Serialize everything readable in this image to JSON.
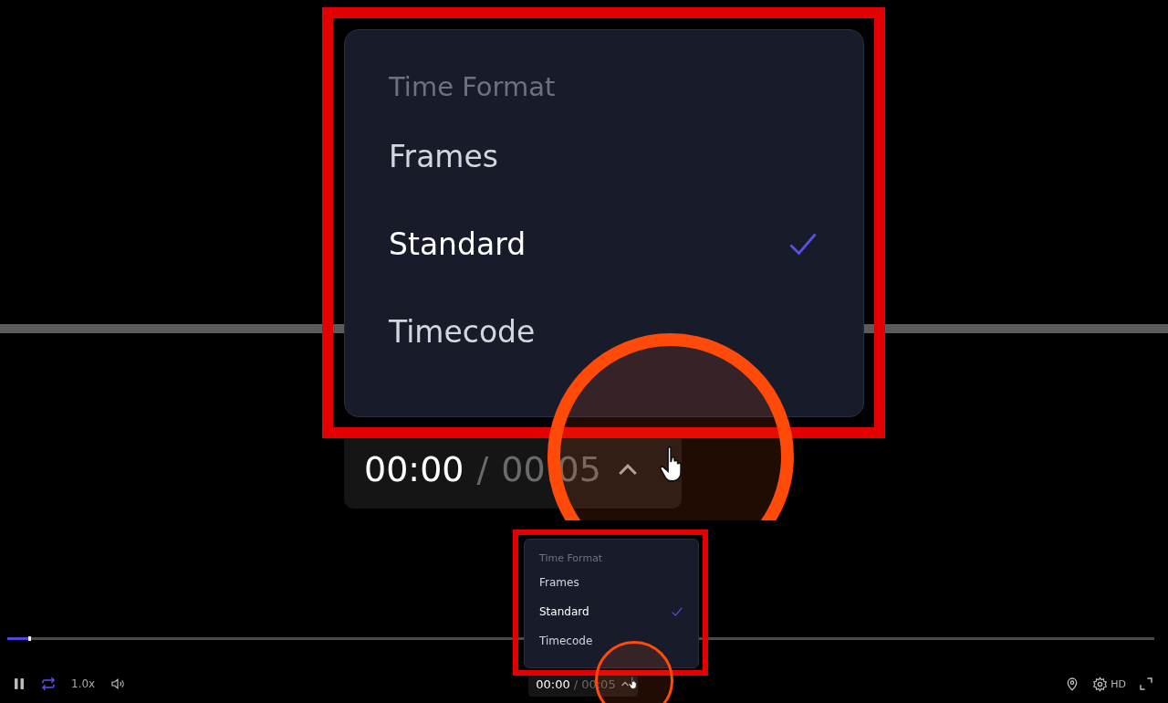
{
  "zoom_inset": {
    "menu": {
      "title": "Time Format",
      "items": [
        {
          "label": "Frames",
          "selected": false
        },
        {
          "label": "Standard",
          "selected": true
        },
        {
          "label": "Timecode",
          "selected": false
        }
      ]
    },
    "time": {
      "current": "00:00",
      "separator": "/",
      "total": "00:05"
    }
  },
  "player": {
    "progress": {
      "level": 0.02
    },
    "loop": {
      "on": true
    },
    "speed": "1.0x",
    "menu": {
      "title": "Time Format",
      "items": [
        {
          "label": "Frames",
          "selected": false
        },
        {
          "label": "Standard",
          "selected": true
        },
        {
          "label": "Timecode",
          "selected": false
        }
      ]
    },
    "time": {
      "current": "00:00",
      "separator": "/",
      "total": "00:05"
    },
    "quality": "HD"
  }
}
